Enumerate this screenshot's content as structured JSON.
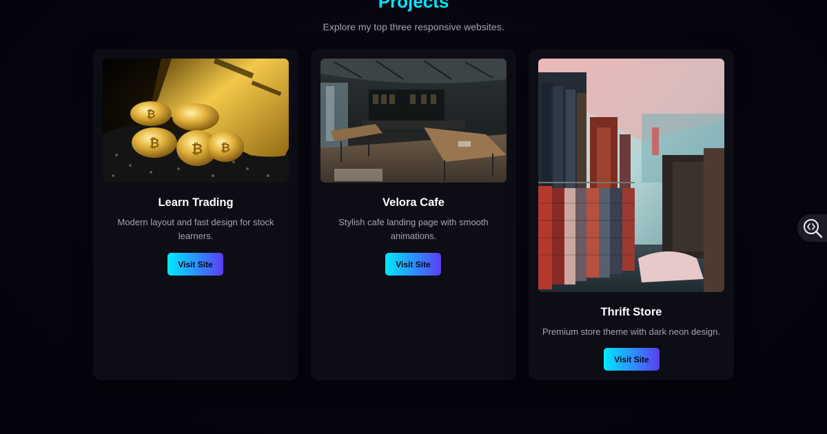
{
  "section": {
    "title": "Projects",
    "subtitle": "Explore my top three responsive websites."
  },
  "projects": [
    {
      "title": "Learn Trading",
      "description": "Modern layout and fast design for stock learners.",
      "button_label": "Visit Site",
      "image_subject": "gold bitcoin coins and gold bar"
    },
    {
      "title": "Velora Cafe",
      "description": "Stylish cafe landing page with smooth animations.",
      "button_label": "Visit Site",
      "image_subject": "cafe interior with wooden tables"
    },
    {
      "title": "Thrift Store",
      "description": "Premium store theme with dark neon design.",
      "button_label": "Visit Site",
      "image_subject": "clothing racks in a thrift store"
    }
  ],
  "floating_tool": {
    "icon": "code-search-icon"
  },
  "colors": {
    "background": "#06050f",
    "card": "#0d0d16",
    "accent": "#00e5ff",
    "button_gradient_start": "#00e8ff",
    "button_gradient_end": "#5a3df0"
  }
}
